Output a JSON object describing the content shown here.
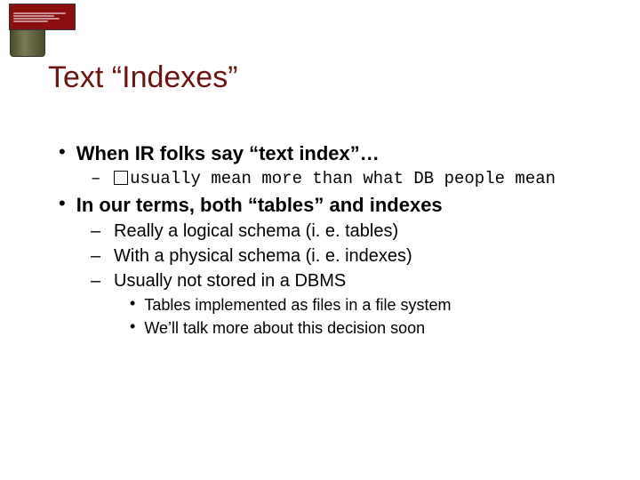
{
  "title": "Text “Indexes”",
  "bullets": {
    "b1": {
      "text": "When IR folks say “text index”…",
      "sub": {
        "s1": "usually mean more than what DB people mean"
      }
    },
    "b2": {
      "text": "In our terms, both “tables” and indexes",
      "sub": {
        "s1": "Really a logical schema (i. e. tables)",
        "s2": "With a physical schema (i. e. indexes)",
        "s3": "Usually not stored in a DBMS"
      },
      "sub2": {
        "t1": "Tables implemented as files in a file system",
        "t2": "We’ll talk more about this decision soon"
      }
    }
  }
}
